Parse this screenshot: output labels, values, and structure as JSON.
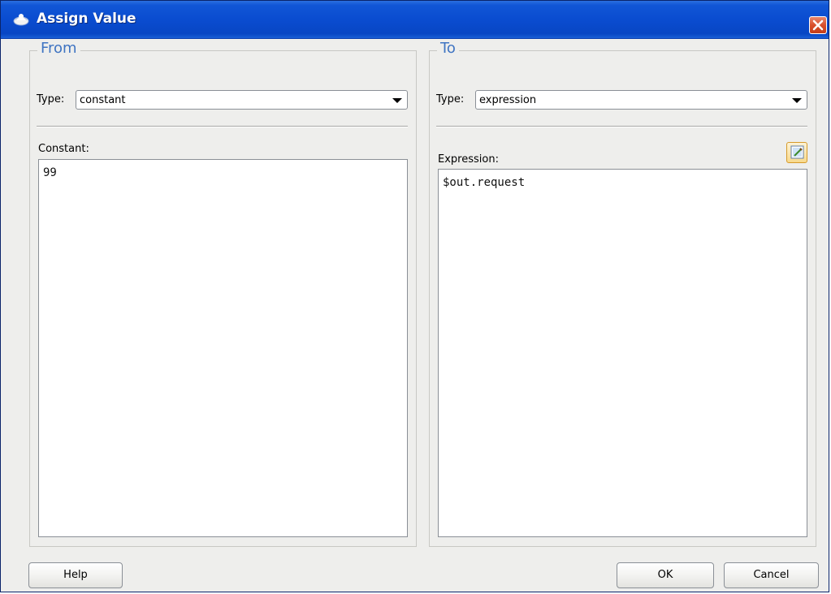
{
  "window": {
    "title": "Assign Value",
    "title_icon": "oracle-bpel-icon",
    "close_icon": "close-icon"
  },
  "from": {
    "legend": "From",
    "type_label": "Type:",
    "type_value": "constant",
    "field_label": "Constant:",
    "field_value": "99"
  },
  "to": {
    "legend": "To",
    "type_label": "Type:",
    "type_value": "expression",
    "field_label": "Expression:",
    "field_value": "$out.request",
    "expression_builder_icon": "expression-builder-icon"
  },
  "buttons": {
    "help": "Help",
    "ok": "OK",
    "cancel": "Cancel"
  },
  "colors": {
    "title_bar": "#0a4cd0",
    "legend": "#3f74c2",
    "close": "#d9502c"
  }
}
